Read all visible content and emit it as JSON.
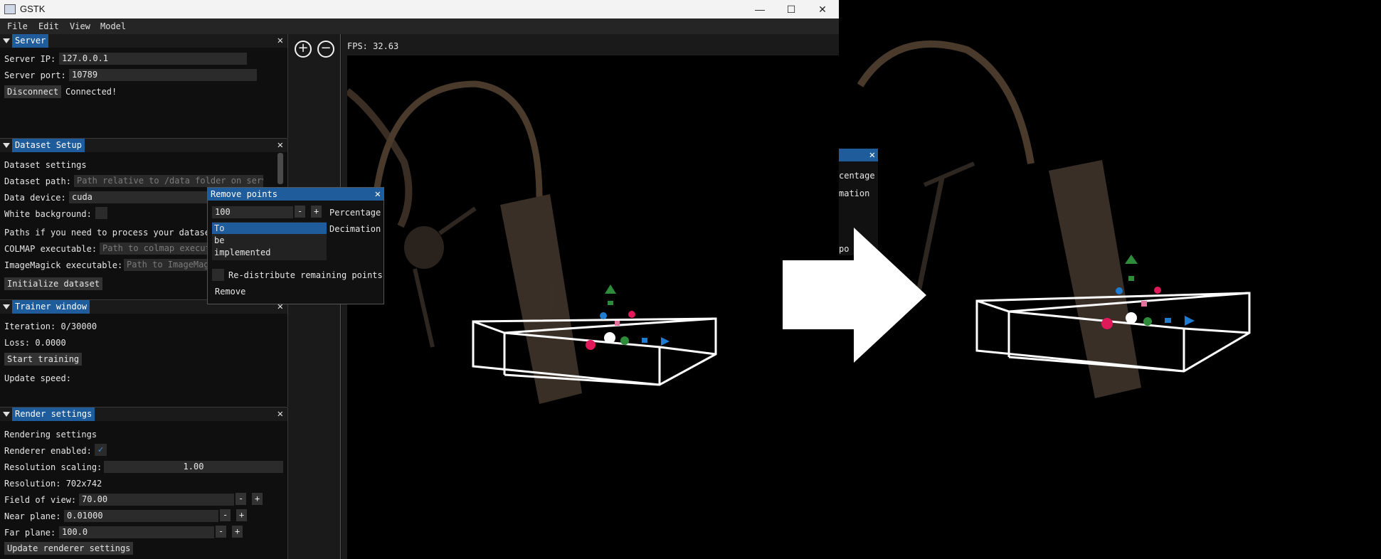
{
  "window": {
    "title": "GSTK",
    "minimize": "—",
    "maximize": "☐",
    "close": "✕"
  },
  "menu": [
    "File",
    "Edit",
    "View",
    "Model"
  ],
  "close_glyph": "✕",
  "server": {
    "title": "Server",
    "ip_label": "Server IP:",
    "ip_value": "127.0.0.1",
    "port_label": "Server port:",
    "port_value": "10789",
    "disconnect": "Disconnect",
    "status": "Connected!"
  },
  "dataset": {
    "title": "Dataset Setup",
    "settings_heading": "Dataset settings",
    "path_label": "Dataset path:",
    "path_placeholder": "Path relative to /data folder on serv",
    "device_label": "Data device:",
    "device_value": "cuda",
    "white_bg_label": "White background:",
    "paths_heading": "Paths if you need to process your dataset",
    "colmap_label": "COLMAP executable:",
    "colmap_placeholder": "Path to colmap execut",
    "imagemagick_label": "ImageMagick executable:",
    "imagemagick_placeholder": "Path to ImageMagic",
    "init_button": "Initialize dataset"
  },
  "trainer": {
    "title": "Trainer window",
    "iteration": "Iteration: 0/30000",
    "loss": "Loss: 0.0000",
    "start_button": "Start training",
    "update_speed": "Update speed:"
  },
  "render": {
    "title": "Render settings",
    "heading": "Rendering settings",
    "enabled_label": "Renderer enabled:",
    "scaling_label": "Resolution scaling:",
    "scaling_value": "1.00",
    "resolution": "Resolution: 702x742",
    "fov_label": "Field of view:",
    "fov_value": "70.00",
    "near_label": "Near plane:",
    "near_value": "0.01000",
    "far_label": "Far plane:",
    "far_value": "100.0",
    "update_button": "Update renderer settings",
    "minus": "-",
    "plus": "+"
  },
  "toolbar": {
    "add_glyph": "+",
    "remove_glyph": "−"
  },
  "viewport": {
    "fps": "FPS: 32.63"
  },
  "remove_points": {
    "title": "Remove points",
    "value": "100",
    "minus": "-",
    "plus": "+",
    "mode_percentage": "Percentage",
    "mode_decimation": "Decimation",
    "list": [
      "To",
      "be",
      "implemented"
    ],
    "redistribute_label": "Re-distribute remaining points",
    "remove_button": "Remove"
  },
  "right_fragment": {
    "line1": "centage",
    "line2": "mation",
    "line3": "po"
  },
  "colors": {
    "accent": "#1f5c9c",
    "gizmo_pink": "#e0195a",
    "gizmo_blue": "#1e7bd0",
    "gizmo_green": "#2e8b3a"
  }
}
